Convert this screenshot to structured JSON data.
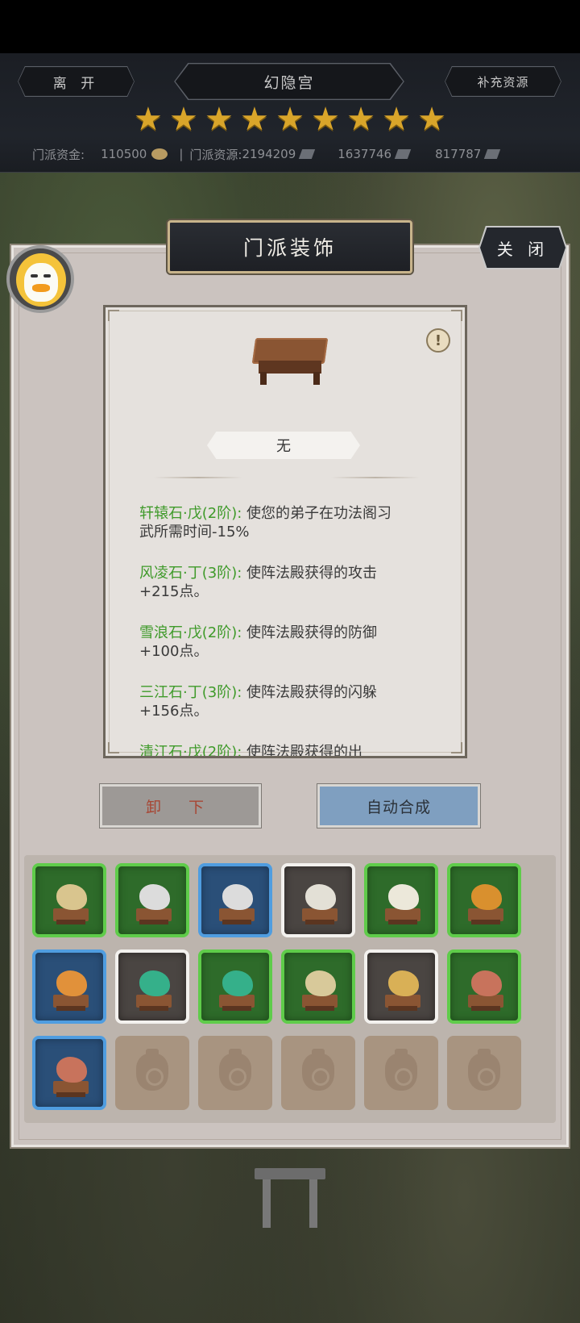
{
  "header": {
    "leave_label": "离 开",
    "sect_name": "幻隐宫",
    "supply_label": "补充资源",
    "star_count": 9,
    "funds_label": "门派资金:",
    "funds_value": "110500",
    "separator": "|",
    "resources_label": "门派资源:",
    "resources_value": "2194209",
    "res2_value": "1637746",
    "res3_value": "817787"
  },
  "panel": {
    "title": "门派装饰",
    "close_label": "关 闭",
    "info_icon_glyph": "!",
    "equipped_name": "无",
    "effects": [
      {
        "name": "轩辕石·戊(2阶):",
        "desc": "使您的弟子在功法阁习武所需时间-15%"
      },
      {
        "name": "风凌石·丁(3阶):",
        "desc": "使阵法殿获得的攻击+215点。"
      },
      {
        "name": "雪浪石·戊(2阶):",
        "desc": "使阵法殿获得的防御+100点。"
      },
      {
        "name": "三江石·丁(3阶):",
        "desc": "使阵法殿获得的闪躲+156点。"
      },
      {
        "name": "清江石·戊(2阶):",
        "desc": "使阵法殿获得的出"
      }
    ],
    "unload_label": "卸 下",
    "auto_label": "自动合成"
  },
  "inventory": {
    "slots": [
      {
        "rarity": "green",
        "rock": "#d9c58e"
      },
      {
        "rarity": "green",
        "rock": "#dcdcdc"
      },
      {
        "rarity": "blue",
        "rock": "#dcdcdc"
      },
      {
        "rarity": "white",
        "rock": "#e3e0d6"
      },
      {
        "rarity": "green",
        "rock": "#ece8da"
      },
      {
        "rarity": "green",
        "rock": "#d9902e"
      },
      {
        "rarity": "blue",
        "rock": "#e1913a"
      },
      {
        "rarity": "white",
        "rock": "#35b08a"
      },
      {
        "rarity": "green",
        "rock": "#35b08a"
      },
      {
        "rarity": "green",
        "rock": "#d8c99a"
      },
      {
        "rarity": "white",
        "rock": "#d9b056"
      },
      {
        "rarity": "green",
        "rock": "#c8735c"
      },
      {
        "rarity": "blue",
        "rock": "#c8735c"
      },
      {
        "rarity": "empty"
      },
      {
        "rarity": "empty"
      },
      {
        "rarity": "empty"
      },
      {
        "rarity": "empty"
      },
      {
        "rarity": "empty"
      }
    ]
  },
  "colors": {
    "effect_name": "#3f9a2a",
    "unload_text": "#a74634",
    "auto_button": "#7f9fc0",
    "star": "#d9a52a"
  }
}
